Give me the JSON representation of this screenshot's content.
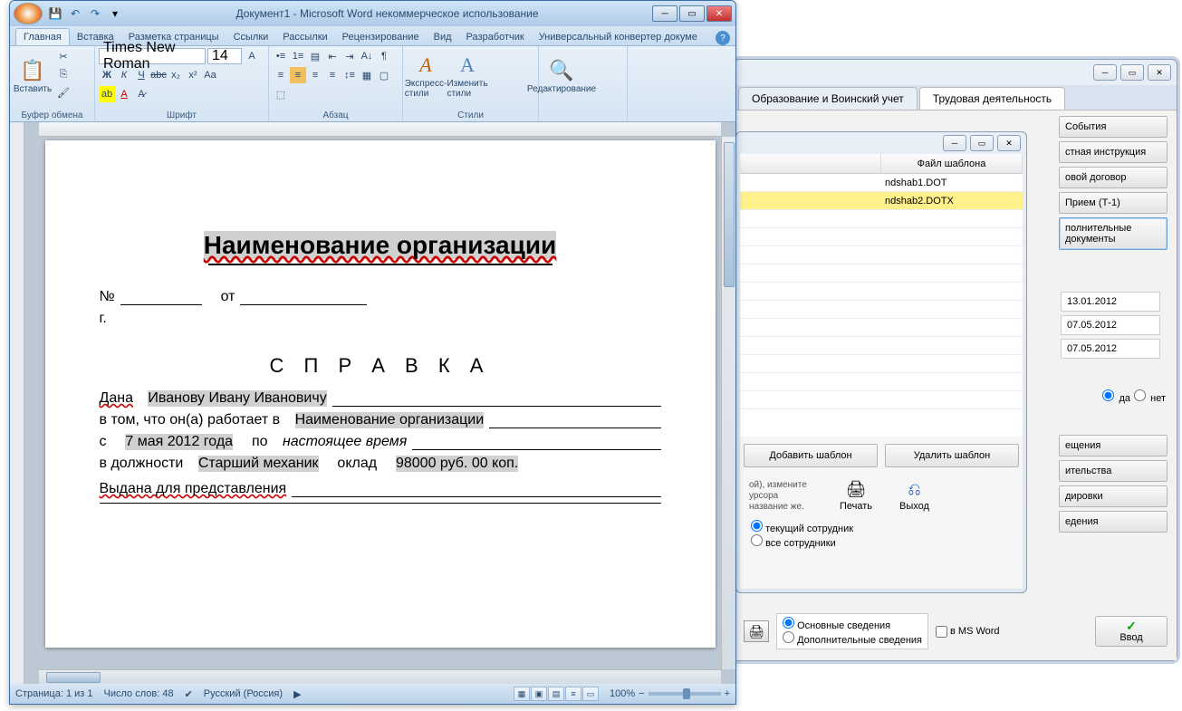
{
  "word": {
    "title": "Документ1 - Microsoft Word некоммерческое использование",
    "tabs": [
      "Главная",
      "Вставка",
      "Разметка страницы",
      "Ссылки",
      "Рассылки",
      "Рецензирование",
      "Вид",
      "Разработчик",
      "Универсальный конвертер докуме"
    ],
    "groups": {
      "clipboard": "Буфер обмена",
      "font": "Шрифт",
      "para": "Абзац",
      "styles": "Стили",
      "edit": "Редактирование"
    },
    "paste": "Вставить",
    "express": "Экспресс-стили",
    "change": "Изменить стили",
    "font_name": "Times New Roman",
    "font_size": "14",
    "status": {
      "page": "Страница: 1 из 1",
      "words": "Число слов: 48",
      "lang": "Русский (Россия)",
      "zoom": "100%"
    }
  },
  "doc": {
    "org": "Наименование организации",
    "no": "№",
    "from": "от",
    "g": "г.",
    "title": "С П Р А В К А",
    "dana": "Дана",
    "name": "Иванову Ивану Ивановичу",
    "works": "в том, что он(а) работает в",
    "org2": "Наименование организации",
    "s": "с",
    "date": "7 мая 2012 года",
    "po": "по",
    "present": "настоящее время",
    "post": "в должности",
    "post_v": "Старший механик",
    "salary": "оклад",
    "salary_v": "98000 руб. 00 коп.",
    "issued": "Выдана для представления"
  },
  "popup": {
    "header": "Файл шаблона",
    "rows": [
      "ndshab1.DOT",
      "ndshab2.DOTX"
    ],
    "add": "Добавить шаблон",
    "del": "Удалить шаблон",
    "hint": "ой), измените урсора название же.",
    "print": "Печать",
    "exit": "Выход",
    "r1": "текущий сотрудник",
    "r2": "все сотрудники"
  },
  "back": {
    "tab1": "Образование и Воинский учет",
    "tab2": "Трудовая деятельность",
    "btns": [
      "События",
      "стная инструкция",
      "овой  договор",
      "Прием (Т-1)"
    ],
    "btn_tall1": "полнительные",
    "btn_tall2": "документы",
    "dates": [
      "13.01.2012",
      "07.05.2012",
      "07.05.2012"
    ],
    "yes": "да",
    "no": "нет",
    "more": [
      "ещения",
      "ительства",
      "дировки",
      "едения"
    ],
    "opt1": "Основные сведения",
    "opt2": "Дополнительные сведения",
    "msword": "в MS Word",
    "vvod": "Ввод"
  }
}
